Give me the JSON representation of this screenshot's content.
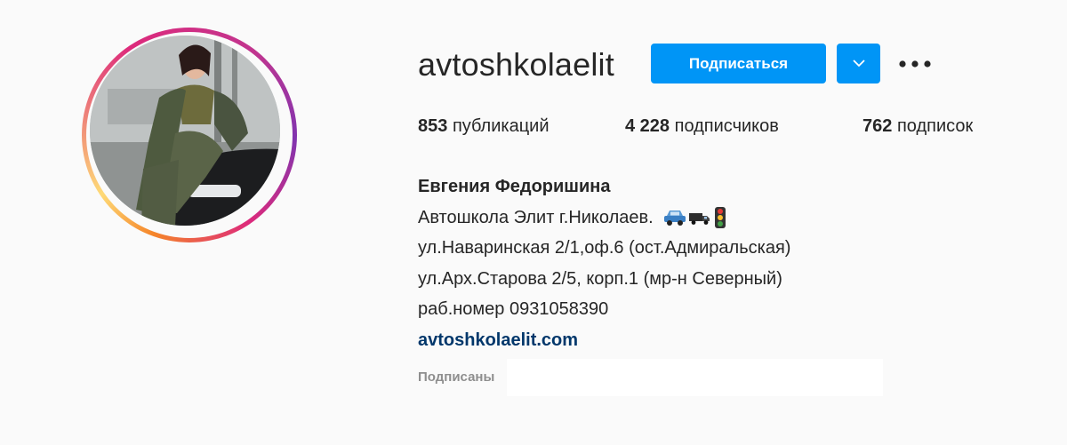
{
  "profile": {
    "username": "avtoshkolaelit",
    "follow_label": "Подписаться",
    "dropdown_icon": "chevron-down-icon",
    "more_icon": "more-horizontal-icon",
    "avatar_ring_colors": [
      "#f58529",
      "#dd2a7b",
      "#8134af"
    ]
  },
  "stats": {
    "posts_count": "853",
    "posts_label": "публикаций",
    "followers_count": "4 228",
    "followers_label": "подписчиков",
    "following_count": "762",
    "following_label": "подписок"
  },
  "bio": {
    "name": "Евгения Федоришина",
    "line1": "Автошкола Элит г.Николаев.",
    "line1_emojis": [
      "car-icon",
      "truck-icon",
      "traffic-light-icon"
    ],
    "line2": "ул.Наваринская 2/1,оф.6 (ост.Адмиральская)",
    "line3": "ул.Арх.Старова 2/5, корп.1 (мр-н Северный)",
    "line4": "раб.номер 0931058390",
    "website": "avtoshkolaelit.com"
  },
  "followed_by": {
    "label": "Подписаны"
  },
  "colors": {
    "accent": "#0095f6",
    "text": "#262626",
    "muted": "#8e8e8e",
    "link": "#00376b",
    "background": "#fafafa"
  }
}
